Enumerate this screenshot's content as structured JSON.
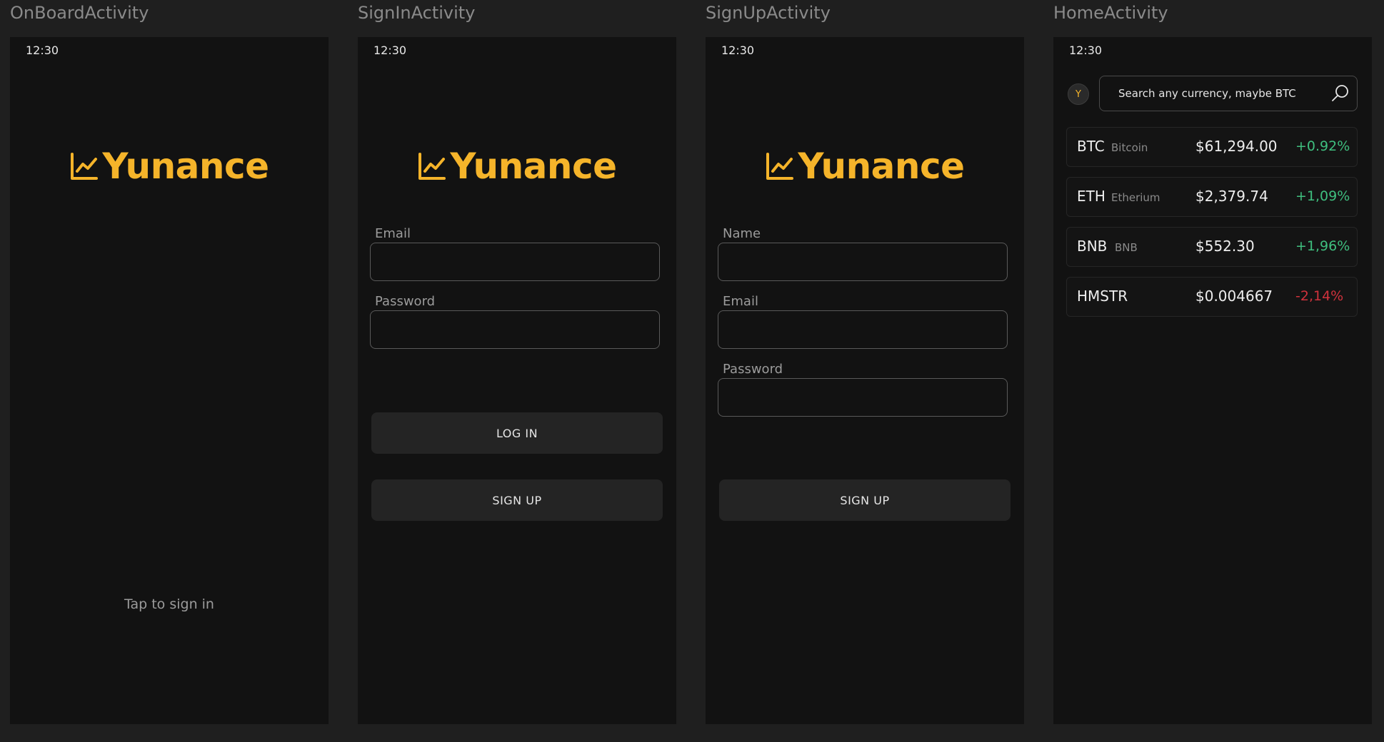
{
  "colors": {
    "accent": "#f5b42a",
    "positive": "#3fbf7f",
    "negative": "#d0323c"
  },
  "screens": {
    "onboard": {
      "title": "OnBoardActivity",
      "time": "12:30",
      "logo": "Yunance",
      "tap_text": "Tap to sign in"
    },
    "signin": {
      "title": "SignInActivity",
      "time": "12:30",
      "logo": "Yunance",
      "email_label": "Email",
      "email_value": "",
      "password_label": "Password",
      "password_value": "",
      "login_button": "LOG IN",
      "signup_button": "SIGN UP"
    },
    "signup": {
      "title": "SignUpActivity",
      "time": "12:30",
      "logo": "Yunance",
      "name_label": "Name",
      "name_value": "",
      "email_label": "Email",
      "email_value": "",
      "password_label": "Password",
      "password_value": "",
      "signup_button": "SIGN UP"
    },
    "home": {
      "title": "HomeActivity",
      "time": "12:30",
      "avatar_letter": "Y",
      "search_placeholder": "Search any currency, maybe BTC",
      "coins": [
        {
          "symbol": "BTC",
          "name": "Bitcoin",
          "price": "$61,294.00",
          "change": "+0.92%",
          "trend": "up"
        },
        {
          "symbol": "ETH",
          "name": "Etherium",
          "price": "$2,379.74",
          "change": "+1,09%",
          "trend": "up"
        },
        {
          "symbol": "BNB",
          "name": "BNB",
          "price": "$552.30",
          "change": "+1,96%",
          "trend": "up"
        },
        {
          "symbol": "HMSTR",
          "name": "",
          "price": "$0.004667",
          "change": "-2,14%",
          "trend": "down"
        }
      ]
    }
  }
}
